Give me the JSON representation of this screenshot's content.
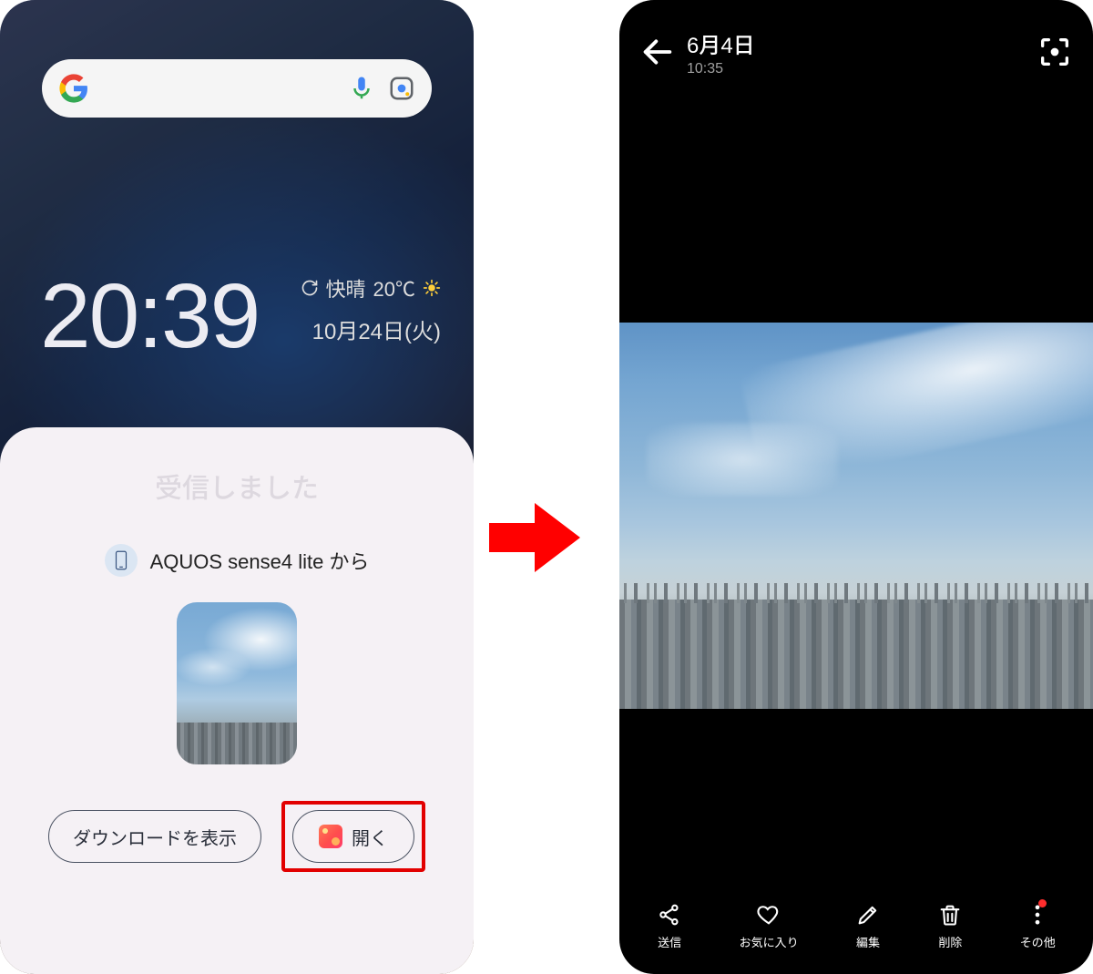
{
  "left": {
    "clock": "20:39",
    "weather": {
      "label": "快晴",
      "temp": "20℃"
    },
    "date": "10月24日(火)",
    "sheet": {
      "title": "受信しました",
      "from_device": "AQUOS sense4 lite から",
      "download_button": "ダウンロードを表示",
      "open_button": "開く"
    }
  },
  "right": {
    "date": "6月4日",
    "time": "10:35",
    "actions": {
      "send": "送信",
      "favorite": "お気に入り",
      "edit": "編集",
      "delete": "削除",
      "more": "その他"
    }
  }
}
